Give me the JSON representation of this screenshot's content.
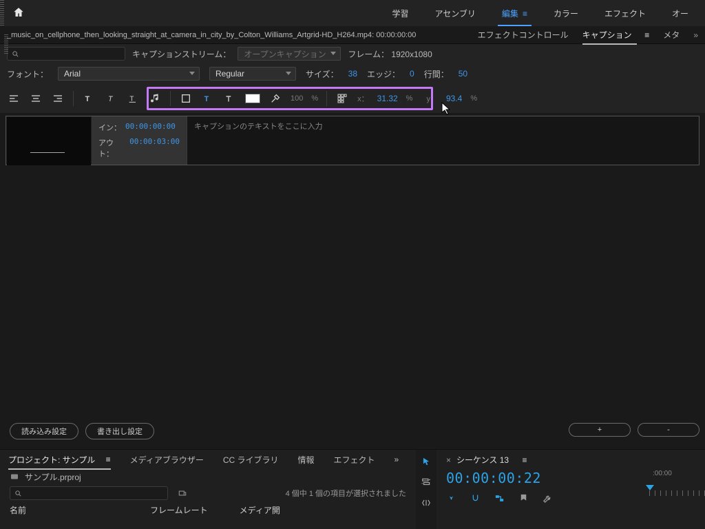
{
  "topnav": {
    "learn": "学習",
    "assembly": "アセンブリ",
    "edit": "編集",
    "color": "カラー",
    "effects": "エフェクト",
    "audio": "オー"
  },
  "sequence": {
    "name": "_music_on_cellphone_then_looking_straight_at_camera_in_city_by_Colton_Williams_Artgrid-HD_H264.mp4: 00:00:00:00",
    "tabs": {
      "effect_controls": "エフェクトコントロール",
      "caption": "キャプション",
      "meta": "メタ"
    }
  },
  "filter": {
    "stream_label": "キャプションストリーム：",
    "stream_value": "オープンキャプション",
    "frame_label": "フレーム：",
    "frame_value": "1920x1080"
  },
  "font": {
    "label": "フォント：",
    "family": "Arial",
    "weight": "Regular",
    "size_label": "サイズ：",
    "size": "38",
    "edge_label": "エッジ：",
    "edge": "0",
    "leading_label": "行間：",
    "leading": "50"
  },
  "toolbar": {
    "opacity": "100",
    "pct": "%",
    "x_label": "x：",
    "x": "31.32",
    "y_label": "y：",
    "y": "93.4"
  },
  "caption": {
    "in_label": "イン：",
    "in": "00:00:00:00",
    "out_label": "アウト：",
    "out": "00:00:03:00",
    "placeholder": "キャプションのテキストをここに入力"
  },
  "buttons": {
    "import_settings": "読み込み設定",
    "export_settings": "書き出し設定",
    "plus": "+",
    "minus": "-"
  },
  "project": {
    "tabs": {
      "project": "プロジェクト: サンプル",
      "media_browser": "メディアブラウザー",
      "cc_library": "CC ライブラリ",
      "info": "情報",
      "effects": "エフェクト"
    },
    "file": "サンプル.prproj",
    "selection": "4 個中 1 個の項目が選択されました",
    "cols": {
      "name": "名前",
      "framerate": "フレームレート",
      "media_start": "メディア開"
    }
  },
  "timeline": {
    "tab": "シーケンス 13",
    "tc": "00:00:00:22",
    "ruler_start": ":00:00"
  },
  "menu_eq": "≡",
  "chev": "»"
}
